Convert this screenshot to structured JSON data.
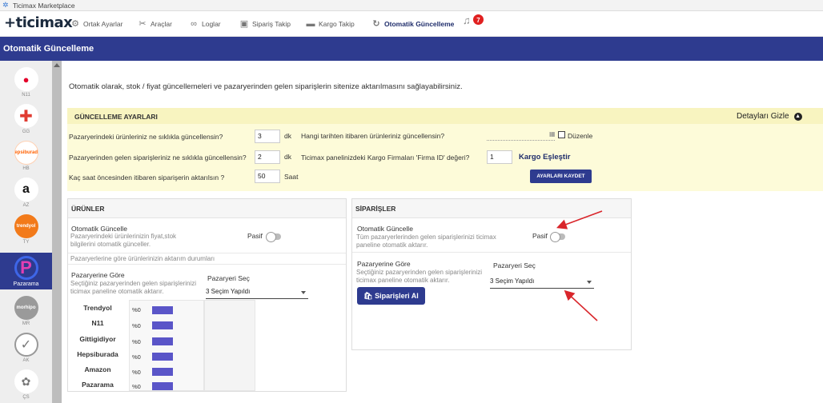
{
  "window": {
    "title": "Ticimax Marketplace"
  },
  "brand": {
    "logo_text": "ticimax"
  },
  "nav": [
    {
      "icon": "gear-icon",
      "label": "Ortak Ayarlar"
    },
    {
      "icon": "tools-icon",
      "label": "Araçlar"
    },
    {
      "icon": "binoculars-icon",
      "label": "Loglar"
    },
    {
      "icon": "box-icon",
      "label": "Sipariş Takip"
    },
    {
      "icon": "truck-icon",
      "label": "Kargo Takip"
    },
    {
      "icon": "sync-icon",
      "label": "Otomatik Güncelleme"
    }
  ],
  "notifications": {
    "count": "7"
  },
  "page": {
    "title": "Otomatik Güncelleme",
    "intro": "Otomatik olarak, stok / fiyat güncellemeleri ve pazaryerinden gelen siparişlerin sitenize aktarılmasını sağlayabilirsiniz."
  },
  "sidebar": [
    {
      "logo": "n11",
      "label": "N11"
    },
    {
      "logo": "gg",
      "label": "GG"
    },
    {
      "logo": "hepsiburada",
      "label": "HB"
    },
    {
      "logo": "a",
      "label": "AZ"
    },
    {
      "logo": "trendyol",
      "label": "TY"
    },
    {
      "logo": "P",
      "label": "Pazarama"
    },
    {
      "logo": "morhipo",
      "label": "MR"
    },
    {
      "logo": "",
      "label": "AK"
    },
    {
      "logo": "",
      "label": "ÇS"
    }
  ],
  "settings": {
    "title": "GÜNCELLEME AYARLARI",
    "toggle_label": "Detayları Gizle",
    "q1": "Pazaryerindeki ürünleriniz ne sıklıkla güncellensin?",
    "q1_value": "3",
    "q1_unit": "dk",
    "q2": "Pazaryerinden gelen siparişleriniz ne sıklıkla güncellensin?",
    "q2_value": "2",
    "q2_unit": "dk",
    "q3": "Kaç saat öncesinden itibaren siparişerin aktarılsın ?",
    "q3_value": "50",
    "q3_unit": "Saat",
    "q4": "Hangi tarihten itibaren ürünleriniz güncellensin?",
    "edit_label": "Düzenle",
    "q5": "Ticimax panelinizdeki Kargo Firmaları 'Firma ID' değeri?",
    "q5_value": "1",
    "kargo_link": "Kargo Eşleştir",
    "save_label": "AYARLARI KAYDET"
  },
  "products": {
    "title": "ÜRÜNLER",
    "auto_title": "Otomatik Güncelle",
    "auto_desc": "Pazaryerindeki ürünlerinizin fiyat,stok bilgilerini otomatik günceller.",
    "status": "Pasif",
    "status_caption": "Pazaryerlerine göre ürünlerinizin aktarım durumları",
    "by_market_title": "Pazaryerine Göre",
    "by_market_desc": "Seçtiğiniz pazaryerinden gelen siparişlerinizi ticimax paneline otomatik aktarır.",
    "select_label": "Pazaryeri Seç",
    "select_value": "3 Seçim Yapıldı",
    "markets": [
      {
        "name": "Trendyol",
        "pct": "%0",
        "fill": 0
      },
      {
        "name": "N11",
        "pct": "%0",
        "fill": 0
      },
      {
        "name": "Gittigidiyor",
        "pct": "%0",
        "fill": 0
      },
      {
        "name": "Hepsiburada",
        "pct": "%0",
        "fill": 0
      },
      {
        "name": "Amazon",
        "pct": "%0",
        "fill": 0
      },
      {
        "name": "Pazarama",
        "pct": "%0",
        "fill": 0
      }
    ]
  },
  "orders": {
    "title": "SİPARİŞLER",
    "auto_title": "Otomatik Güncelle",
    "auto_desc": "Tüm pazaryerlerinden gelen siparişlerinizi ticimax paneline otomatik aktarır.",
    "status": "Pasif",
    "by_market_title": "Pazaryerine Göre",
    "by_market_desc": "Seçtiğiniz pazaryerinden gelen siparişlerinizi ticimax paneline otomatik aktarır.",
    "select_label": "Pazaryeri Seç",
    "select_value": "3 Seçim Yapıldı",
    "fetch_label": "Siparişleri Al"
  },
  "colors": {
    "primary": "#2e3b8f",
    "highlight": "#fdfbd9",
    "bar": "#5a55c8",
    "annotation": "#d9262b"
  }
}
